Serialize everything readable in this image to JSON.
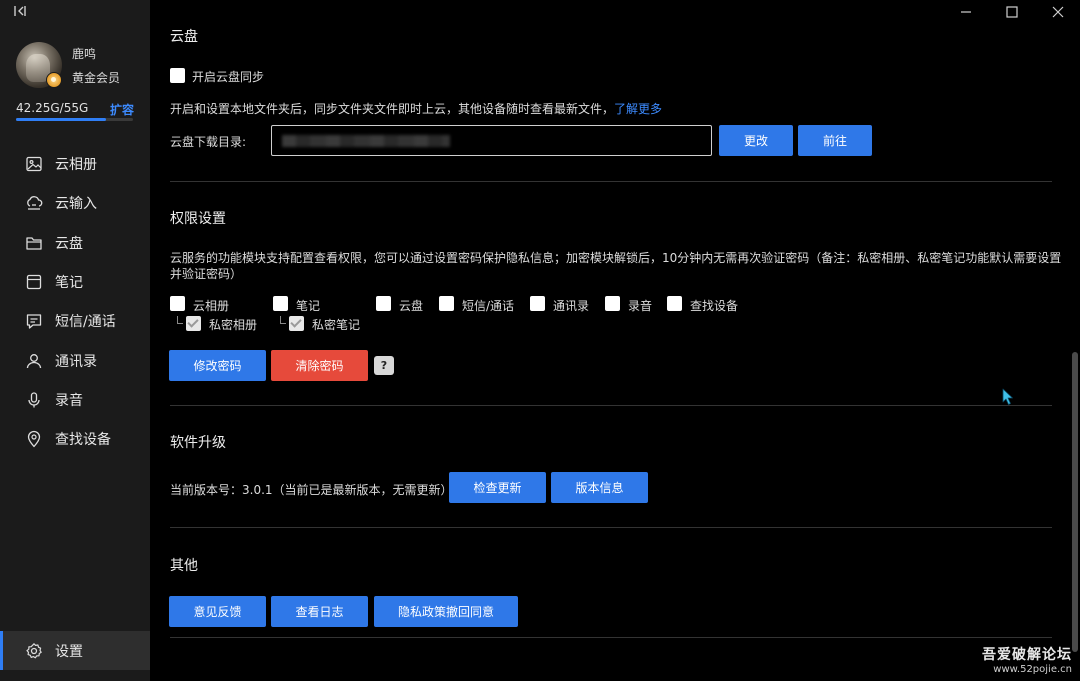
{
  "sidebar": {
    "user": {
      "name": "鹿鸣",
      "level": "黄金会员"
    },
    "storage": {
      "text": "42.25G/55G",
      "expand_label": "扩容",
      "used_fraction": 0.768
    },
    "items": [
      {
        "label": "云相册",
        "icon": "photo-album-icon"
      },
      {
        "label": "云输入",
        "icon": "cloud-input-icon"
      },
      {
        "label": "云盘",
        "icon": "folder-icon"
      },
      {
        "label": "笔记",
        "icon": "notebook-icon"
      },
      {
        "label": "短信/通话",
        "icon": "message-icon"
      },
      {
        "label": "通讯录",
        "icon": "contacts-icon"
      },
      {
        "label": "录音",
        "icon": "microphone-icon"
      },
      {
        "label": "查找设备",
        "icon": "location-pin-icon"
      }
    ],
    "settings": {
      "label": "设置",
      "icon": "gear-icon"
    }
  },
  "cloud_drive": {
    "title": "云盘",
    "sync_label": "开启云盘同步",
    "description": "开启和设置本地文件夹后，同步文件夹文件即时上云，其他设备随时查看最新文件，",
    "learn_more": "了解更多",
    "download_dir_label": "云盘下载目录:",
    "change_button": "更改",
    "goto_button": "前往"
  },
  "permissions": {
    "title": "权限设置",
    "description_line1": "云服务的功能模块支持配置查看权限，您可以通过设置密码保护隐私信息；加密模块解锁后，10分钟内无需再次验证密码（备注：私密相册、私密笔记功能默认需要设置",
    "description_line2": "并验证密码）",
    "modules": [
      "云相册",
      "笔记",
      "云盘",
      "短信/通话",
      "通讯录",
      "录音",
      "查找设备"
    ],
    "sub_modules": [
      "私密相册",
      "私密笔记"
    ],
    "modify_password_button": "修改密码",
    "clear_password_button": "清除密码",
    "help_button": "?"
  },
  "upgrade": {
    "title": "软件升级",
    "version_text": "当前版本号：3.0.1（当前已是最新版本，无需更新）",
    "check_update_button": "检查更新",
    "version_info_button": "版本信息"
  },
  "other": {
    "title": "其他",
    "feedback_button": "意见反馈",
    "log_button": "查看日志",
    "privacy_button": "隐私政策撤回同意"
  },
  "watermark": {
    "title": "吾爱破解论坛",
    "url": "www.52pojie.cn"
  },
  "colors": {
    "accent": "#2f78e8",
    "danger": "#e64a3b",
    "link": "#3d8bff",
    "sidebar_bg": "#1b1b1b",
    "main_bg": "#000000"
  }
}
